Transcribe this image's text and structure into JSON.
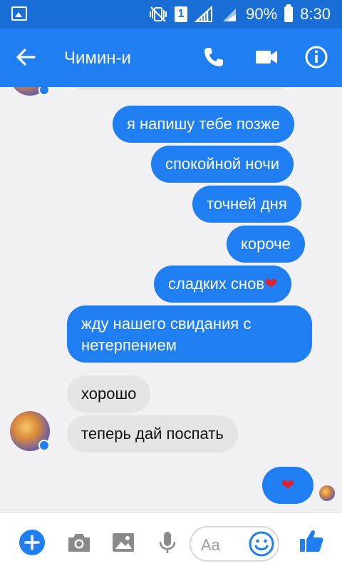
{
  "status_bar": {
    "sim": "1",
    "battery": "90%",
    "time": "8:30"
  },
  "header": {
    "title": "Чимин-и"
  },
  "messages": [
    {
      "text": "я напишу тебе позже"
    },
    {
      "text": "спокойной ночи"
    },
    {
      "text": "точней дня"
    },
    {
      "text": "короче"
    },
    {
      "text": "сладких снов",
      "emoji": "❤"
    },
    {
      "line1": "жду нашего свидания с",
      "line2": "нетерпением"
    },
    {
      "text": "хорошо"
    },
    {
      "text": "теперь дай поспать"
    },
    {
      "emoji": "❤"
    }
  ],
  "composer": {
    "placeholder": "Aa"
  },
  "colors": {
    "accent": "#1e7ef2",
    "status_bar": "#1a6fd6",
    "incoming_bubble": "#e5e4e9",
    "heart": "#e4212b"
  }
}
